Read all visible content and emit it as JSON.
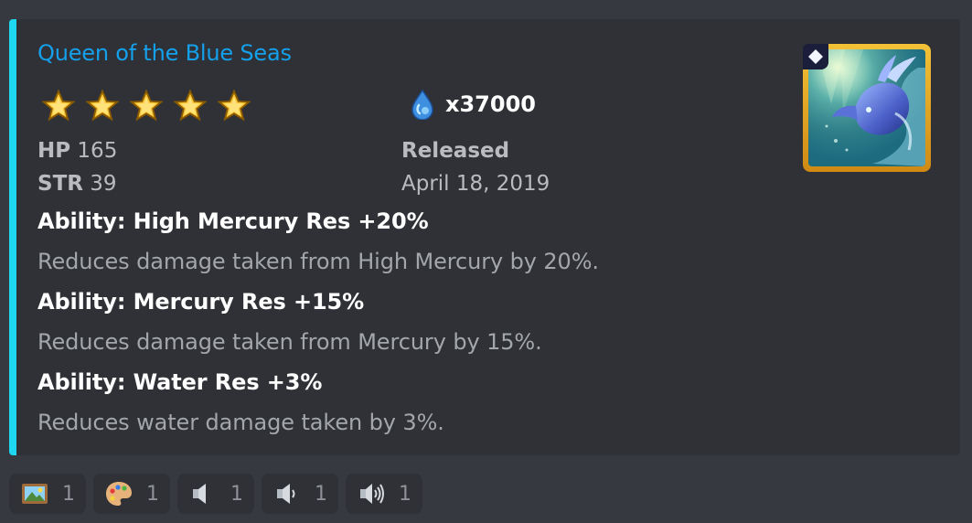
{
  "embed": {
    "accent_color": "#1ed7f0",
    "title": "Queen of the Blue Seas",
    "rarity_stars": 5,
    "currency": {
      "icon": "water-drop-icon",
      "text": "x37000"
    },
    "stats": {
      "hp_label": "HP",
      "hp_value": "165",
      "str_label": "STR",
      "str_value": "39"
    },
    "released": {
      "label": "Released",
      "date": "April 18, 2019"
    },
    "abilities": [
      {
        "title": "Ability: High Mercury Res +20%",
        "description": "Reduces damage taken from High Mercury by 20%."
      },
      {
        "title": "Ability: Mercury Res +15%",
        "description": "Reduces damage taken from Mercury by 15%."
      },
      {
        "title": "Ability: Water Res +3%",
        "description": "Reduces water damage taken by 3%."
      }
    ],
    "thumbnail": {
      "icon": "sea-dragon-portrait",
      "badge_icon": "diamond-icon",
      "frame_color": "#f3c237"
    }
  },
  "reactions": [
    {
      "icon": "framed-picture-icon",
      "count": "1"
    },
    {
      "icon": "artist-palette-icon",
      "count": "1"
    },
    {
      "icon": "speaker-icon",
      "count": "1"
    },
    {
      "icon": "speaker-low-volume-icon",
      "count": "1"
    },
    {
      "icon": "speaker-high-volume-icon",
      "count": "1"
    }
  ]
}
